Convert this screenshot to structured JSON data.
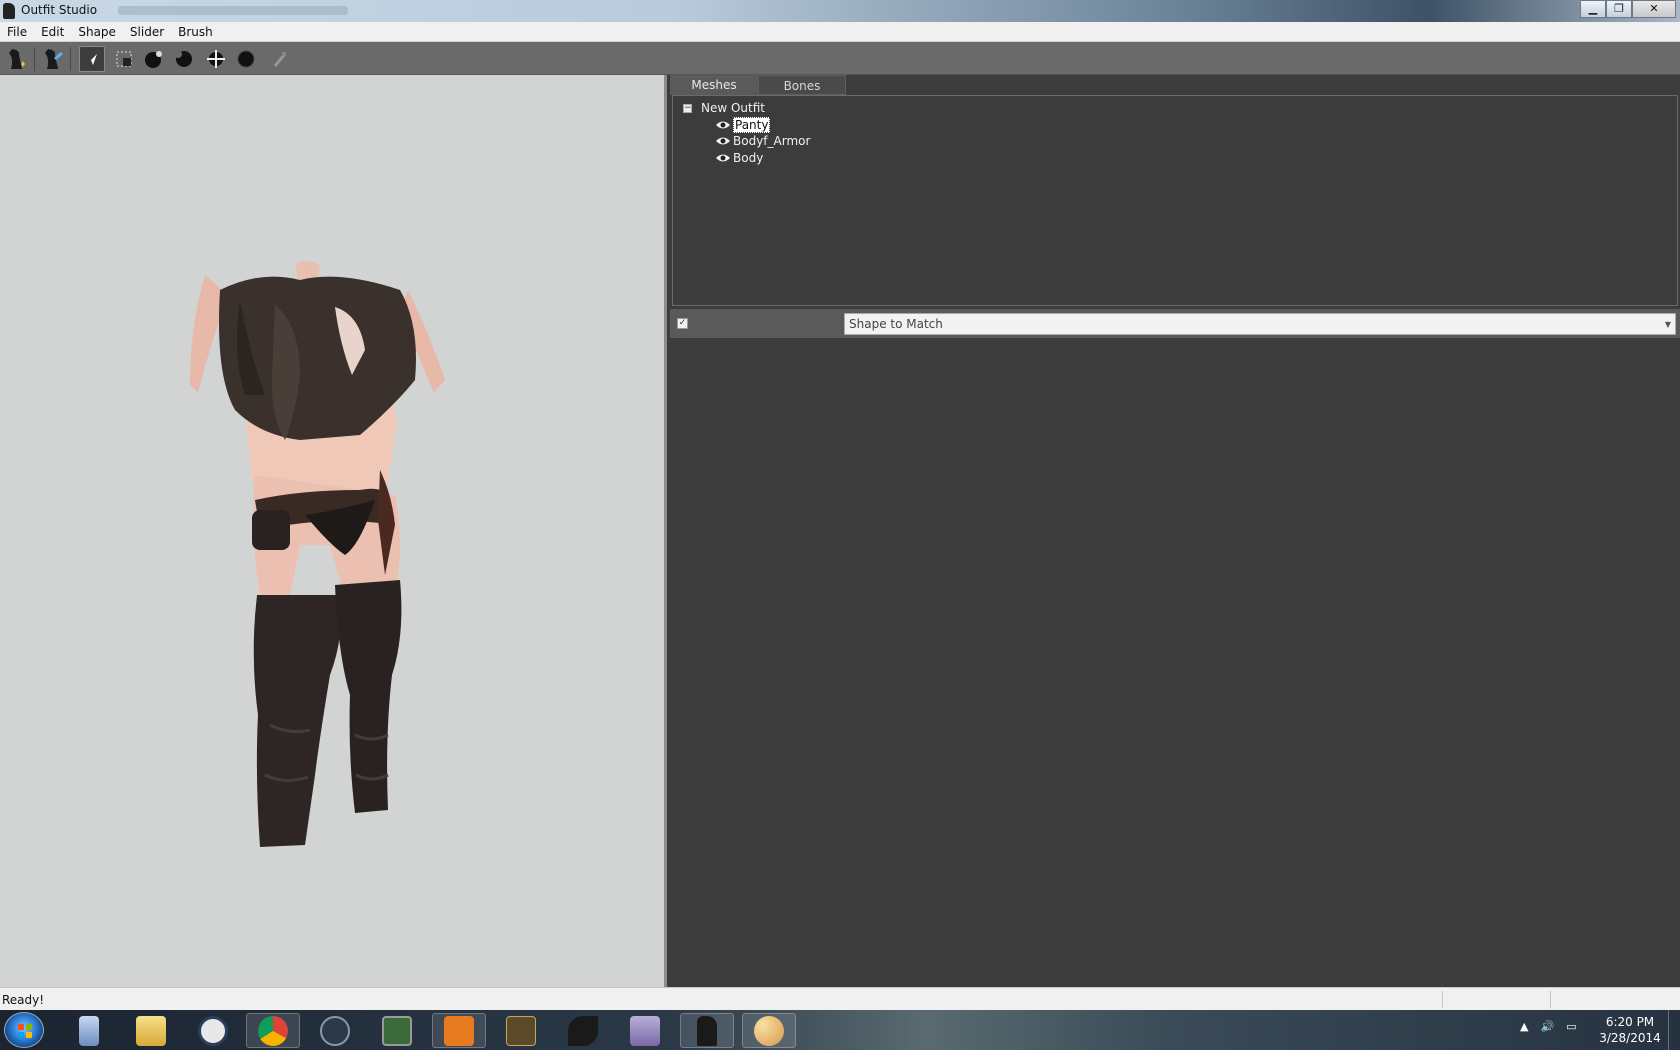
{
  "window": {
    "title": "Outfit Studio",
    "controls": [
      "minimize",
      "maximize",
      "close"
    ]
  },
  "menu": {
    "items": [
      "File",
      "Edit",
      "Shape",
      "Slider",
      "Brush"
    ]
  },
  "toolbar": {
    "tools": [
      {
        "name": "new-project-icon"
      },
      {
        "name": "load-outfit-icon"
      },
      {
        "name": "select-tool-icon",
        "active": true
      },
      {
        "name": "mask-brush-icon"
      },
      {
        "name": "inflate-brush-icon"
      },
      {
        "name": "deflate-brush-icon"
      },
      {
        "name": "move-brush-icon"
      },
      {
        "name": "smooth-brush-icon"
      },
      {
        "name": "weight-brush-icon"
      }
    ]
  },
  "panel": {
    "tabs": [
      {
        "label": "Meshes",
        "active": true
      },
      {
        "label": "Bones",
        "active": false
      }
    ],
    "tree": {
      "root": "New Outfit",
      "shapes": [
        {
          "label": "Panty",
          "selected": true,
          "visible": true
        },
        {
          "label": "Bodyf_Armor",
          "selected": false,
          "visible": true
        },
        {
          "label": "Body",
          "selected": false,
          "visible": true
        }
      ]
    },
    "reference": {
      "checked": true,
      "dropdown_value": "Shape to Match"
    }
  },
  "status": {
    "text": "Ready!"
  },
  "taskbar": {
    "apps": [
      "calculator",
      "file-explorer",
      "steam-obs",
      "chrome",
      "steam",
      "task-manager",
      "app-orange",
      "game-launcher",
      "app-bird",
      "app-dvd",
      "outfit-studio",
      "paint"
    ],
    "clock_time": "6:20 PM",
    "clock_date": "3/28/2014"
  },
  "colors": {
    "viewport_bg": "#d2d4d4",
    "panel_bg": "#3c3c3c",
    "toolbar_bg": "#6a6a6a"
  }
}
